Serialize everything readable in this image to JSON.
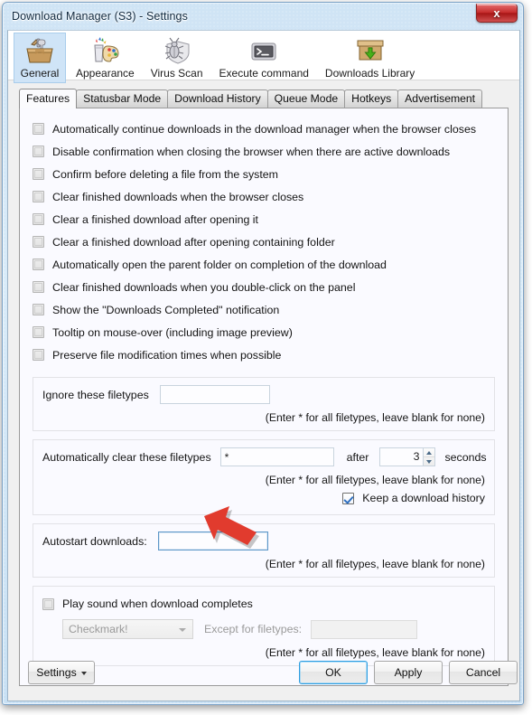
{
  "window": {
    "title": "Download Manager (S3) - Settings",
    "close_label": "x",
    "close_icon": "close-icon"
  },
  "toolbar": {
    "items": [
      {
        "label": "General",
        "icon": "toolbox-icon",
        "selected": true
      },
      {
        "label": "Appearance",
        "icon": "paint-palette-icon",
        "selected": false
      },
      {
        "label": "Virus Scan",
        "icon": "bug-shield-icon",
        "selected": false
      },
      {
        "label": "Execute command",
        "icon": "terminal-icon",
        "selected": false
      },
      {
        "label": "Downloads Library",
        "icon": "download-box-icon",
        "selected": false
      }
    ]
  },
  "tabs": [
    {
      "label": "Features",
      "active": true
    },
    {
      "label": "Statusbar Mode",
      "active": false
    },
    {
      "label": "Download History",
      "active": false
    },
    {
      "label": "Queue Mode",
      "active": false
    },
    {
      "label": "Hotkeys",
      "active": false
    },
    {
      "label": "Advertisement",
      "active": false
    }
  ],
  "features": {
    "checkboxes": [
      {
        "label": "Automatically continue downloads in the download manager when the browser closes",
        "checked": false
      },
      {
        "label": "Disable confirmation when closing the browser when there are active downloads",
        "checked": false
      },
      {
        "label": "Confirm before deleting a file from the system",
        "checked": false
      },
      {
        "label": "Clear finished downloads when the browser closes",
        "checked": false
      },
      {
        "label": "Clear a finished download after opening it",
        "checked": false
      },
      {
        "label": "Clear a finished download after opening containing folder",
        "checked": false
      },
      {
        "label": "Automatically open the parent folder on completion of the download",
        "checked": false
      },
      {
        "label": "Clear finished downloads when you double-click on the panel",
        "checked": false
      },
      {
        "label": "Show the \"Downloads Completed\" notification",
        "checked": false
      },
      {
        "label": "Tooltip on mouse-over (including image preview)",
        "checked": false
      },
      {
        "label": "Preserve file modification times when possible",
        "checked": false
      }
    ],
    "hint_text": "(Enter * for all filetypes, leave blank for none)",
    "group_ignore": {
      "label": "Ignore these filetypes",
      "value": "",
      "placeholder": ""
    },
    "group_autoclear": {
      "label": "Automatically clear these filetypes",
      "value": "*",
      "after_label": "after",
      "seconds_value": "3",
      "seconds_label": "seconds",
      "keep_history_label": "Keep a download history",
      "keep_history_checked": true
    },
    "group_autostart": {
      "label": "Autostart downloads:",
      "value": "",
      "focused": true
    },
    "group_sound": {
      "label": "Play sound when download completes",
      "checked": false,
      "sound_selected": "Checkmark!",
      "except_label": "Except for filetypes:",
      "except_value": "",
      "disabled": true
    }
  },
  "footer": {
    "settings_label": "Settings",
    "ok_label": "OK",
    "apply_label": "Apply",
    "cancel_label": "Cancel"
  },
  "annotation": {
    "type": "red-arrow",
    "color": "#e13b2e",
    "points_at": "autostart-downloads-input"
  },
  "colors": {
    "accent": "#2f9ee0",
    "titlebar": "#cfe4f5",
    "annotation_red": "#e13b2e",
    "checkbox_check": "#2f6fc0"
  }
}
